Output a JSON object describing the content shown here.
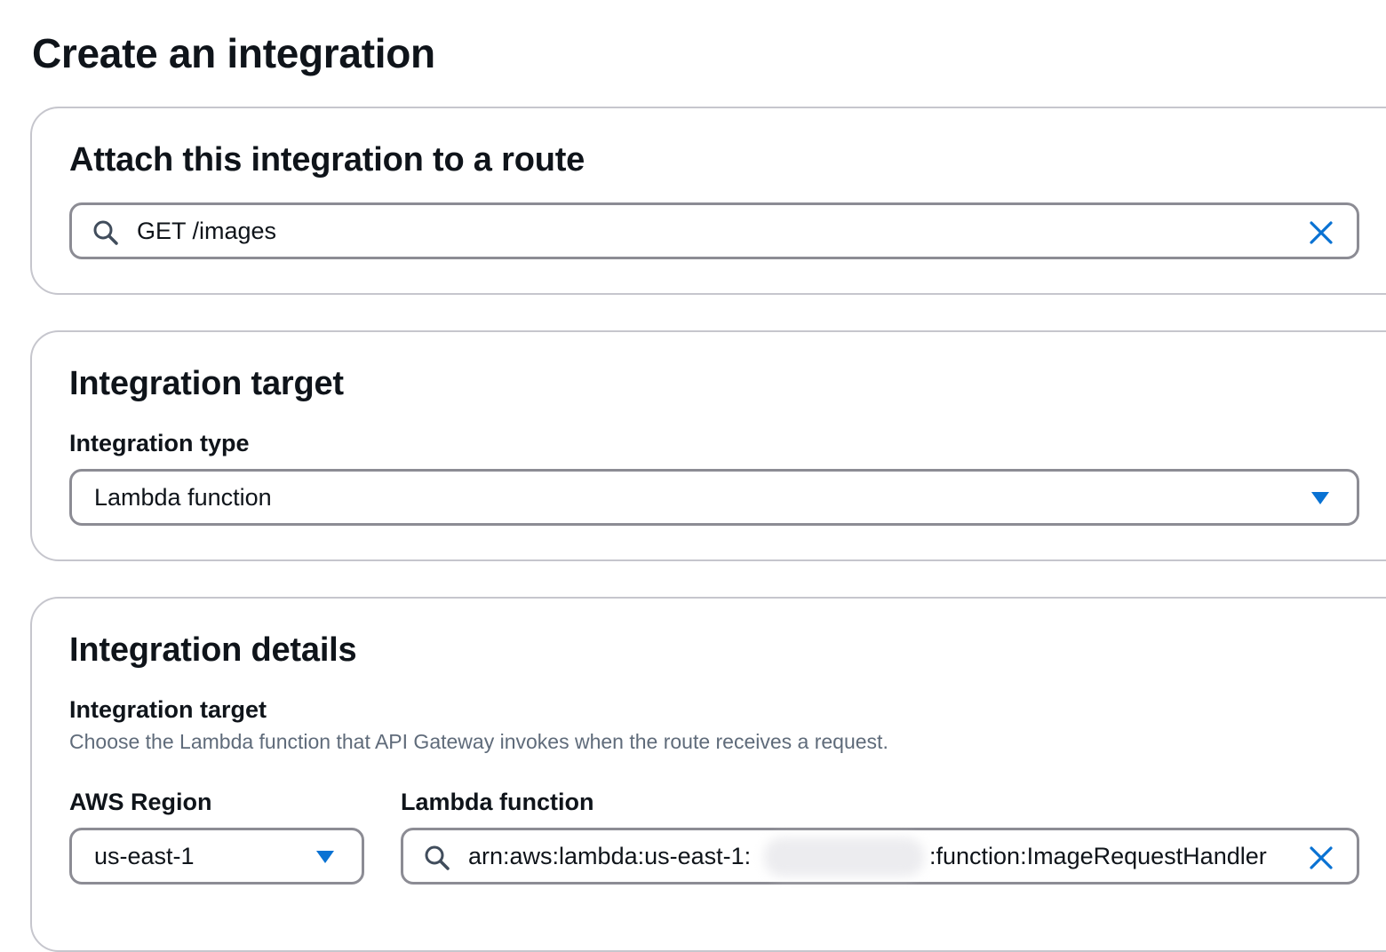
{
  "page": {
    "title": "Create an integration"
  },
  "route_section": {
    "title": "Attach this integration to a route",
    "route_value": "GET /images"
  },
  "target_section": {
    "title": "Integration target",
    "type_label": "Integration type",
    "type_value": "Lambda function"
  },
  "details_section": {
    "title": "Integration details",
    "target_label": "Integration target",
    "target_description": "Choose the Lambda function that API Gateway invokes when the route receives a request.",
    "region_label": "AWS Region",
    "region_value": "us-east-1",
    "lambda_label": "Lambda function",
    "lambda_value_prefix": "arn:aws:lambda:us-east-1:",
    "lambda_value_suffix": ":function:ImageRequestHandler"
  },
  "colors": {
    "accent": "#0972d3",
    "border": "#8c8c94",
    "panel_border": "#c6c6cd",
    "text": "#0f141a",
    "muted": "#5f6b7a"
  },
  "icons": {
    "search": "search-icon",
    "clear": "close-icon",
    "dropdown": "caret-down-icon"
  }
}
